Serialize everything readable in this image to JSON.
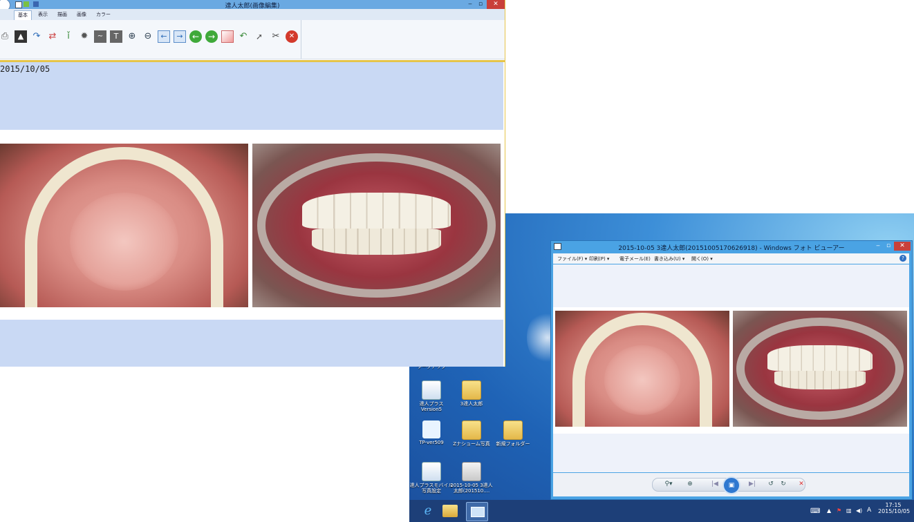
{
  "editor": {
    "title": "達人太郎(画像編集)",
    "tabs": [
      "基本",
      "表示",
      "描画",
      "画像",
      "カラー"
    ],
    "active_tab": "基本",
    "date": "2015/10/05",
    "toolbar_icons": [
      "print-icon",
      "levels-icon",
      "rotate-icon",
      "flip-icon",
      "bottle-icon",
      "brightness-icon",
      "line-icon",
      "text-icon",
      "zoom-in-icon",
      "zoom-out-icon",
      "back-icon",
      "forward-icon",
      "prev-icon",
      "next-icon",
      "image-icon",
      "undo-icon",
      "pointer-icon",
      "cut-icon",
      "close-icon"
    ]
  },
  "viewer": {
    "title": "2015-10-05 3達人太郎(20151005170626918) - Windows フォト ビューアー",
    "menu": [
      "ファイル(F)",
      "印刷(P)",
      "電子メール(E)",
      "書き込み(U)",
      "開く(O)"
    ],
    "help": "?"
  },
  "desktop": {
    "icons": [
      {
        "label": "ワークアップ"
      },
      {
        "label": "達人プラス Version5"
      },
      {
        "label": "3達人太郎"
      },
      {
        "label": "TP-ver509"
      },
      {
        "label": "Zナショーム写真"
      },
      {
        "label": "新規フォルダー"
      },
      {
        "label": "達人プラスモバイル写真設定"
      },
      {
        "label": "2015-10-05 3達人太郎(201510...."
      }
    ]
  },
  "taskbar": {
    "time": "17:15",
    "date": "2015/10/05",
    "ime": "A"
  }
}
